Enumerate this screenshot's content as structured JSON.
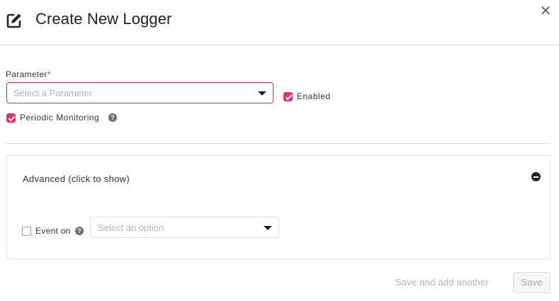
{
  "dialog": {
    "title": "Create New Logger",
    "close_glyph": "✕"
  },
  "form": {
    "parameter": {
      "label": "Parameter",
      "required_mark": "*",
      "placeholder": "Select a Parameter"
    },
    "enabled": {
      "label": "Enabled",
      "checked": true
    },
    "periodic_monitoring": {
      "label": "Periodic Monitoring",
      "checked": true,
      "help_glyph": "?"
    }
  },
  "advanced": {
    "title": "Advanced (click to show)",
    "event_on": {
      "label": "Event on",
      "checked": false,
      "help_glyph": "?",
      "placeholder": "Select an option"
    }
  },
  "footer": {
    "save_and_add_label": "Save and add another",
    "save_label": "Save"
  },
  "colors": {
    "accent": "#e1306c",
    "text": "#333333",
    "placeholder": "#b3b3b3",
    "disabled_text": "#a8a8a8",
    "border": "#dcdcdc"
  }
}
